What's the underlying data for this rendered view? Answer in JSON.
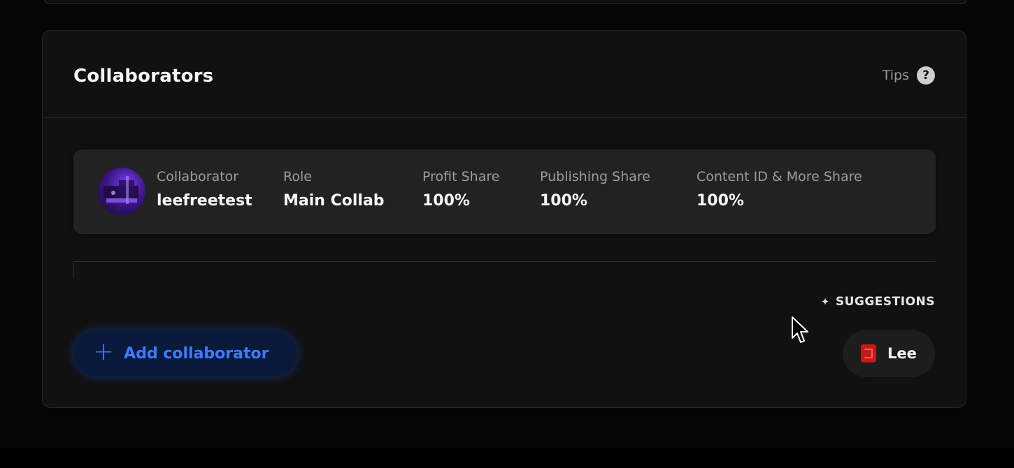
{
  "section": {
    "title": "Collaborators",
    "tips_label": "Tips",
    "help_glyph": "?"
  },
  "collaborator": {
    "avatar_icon": "avatar-icon",
    "fields": [
      {
        "label": "Collaborator",
        "value": "leefreetest"
      },
      {
        "label": "Role",
        "value": "Main Collab"
      },
      {
        "label": "Profit Share",
        "value": "100%"
      },
      {
        "label": "Publishing Share",
        "value": "100%"
      },
      {
        "label": "Content ID & More Share",
        "value": "100%"
      }
    ]
  },
  "suggestions": {
    "label": "SUGGESTIONS",
    "icon": "wand-icon",
    "chips": [
      {
        "label": "Lee"
      }
    ]
  },
  "actions": {
    "add_glyph": "+",
    "add_label": "Add collaborator"
  },
  "colors": {
    "accent_blue": "#3d7bff",
    "card_bg": "#111111",
    "row_bg": "#222222",
    "chip_avatar_red": "#c41a1a"
  }
}
